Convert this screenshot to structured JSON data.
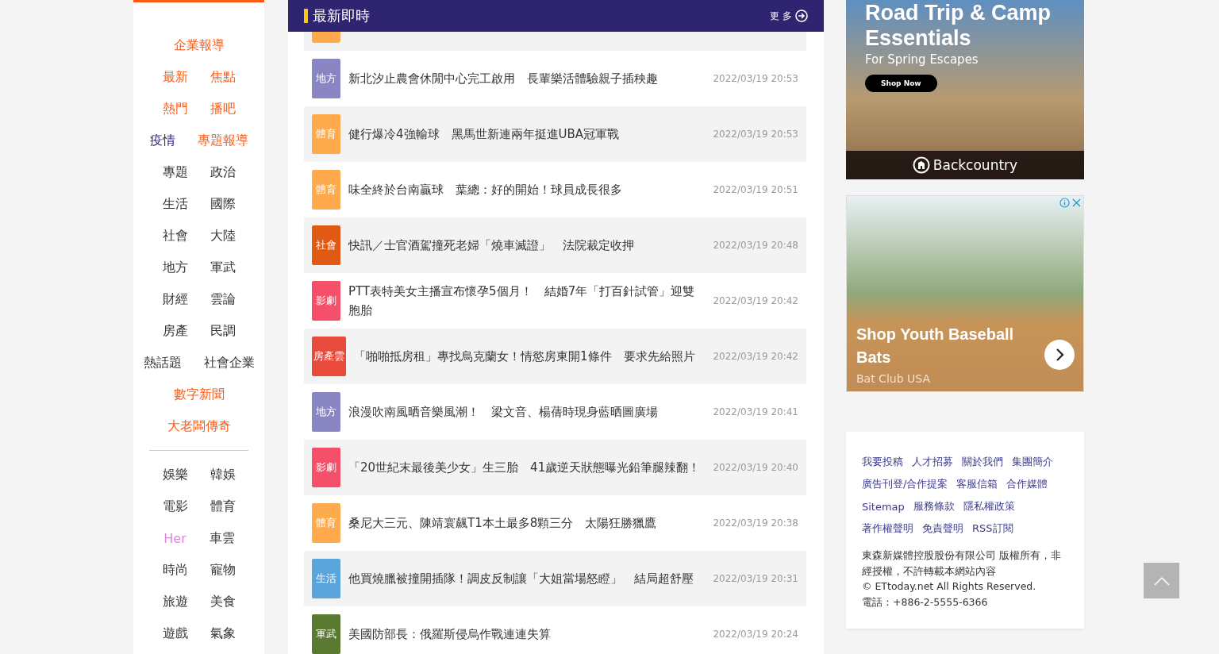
{
  "nav": {
    "sections": [
      [
        [
          {
            "label": "企業報導",
            "color": "#ff5a14"
          }
        ],
        [
          {
            "label": "最新",
            "color": "#ff5a14"
          },
          {
            "label": "焦點",
            "color": "#ff5a14"
          }
        ],
        [
          {
            "label": "熱門",
            "color": "#ff5a14"
          },
          {
            "label": "播吧",
            "color": "#ff5a14"
          }
        ],
        [
          {
            "label": "疫情",
            "color": "#2e2470"
          },
          {
            "label": "專題報導",
            "color": "#ff5a14"
          }
        ],
        [
          {
            "label": "專題",
            "color": "#333333"
          },
          {
            "label": "政治",
            "color": "#333333"
          }
        ],
        [
          {
            "label": "生活",
            "color": "#333333"
          },
          {
            "label": "國際",
            "color": "#333333"
          }
        ],
        [
          {
            "label": "社會",
            "color": "#333333"
          },
          {
            "label": "大陸",
            "color": "#333333"
          }
        ],
        [
          {
            "label": "地方",
            "color": "#333333"
          },
          {
            "label": "軍武",
            "color": "#333333"
          }
        ],
        [
          {
            "label": "財經",
            "color": "#333333"
          },
          {
            "label": "雲論",
            "color": "#333333"
          }
        ],
        [
          {
            "label": "房產",
            "color": "#333333"
          },
          {
            "label": "民調",
            "color": "#333333"
          }
        ],
        [
          {
            "label": "熱話題",
            "color": "#333333"
          },
          {
            "label": "社會企業",
            "color": "#333333"
          }
        ],
        [
          {
            "label": "數字新聞",
            "color": "#ff5a14"
          }
        ],
        [
          {
            "label": "大老闆傳奇",
            "color": "#ff5a14"
          }
        ]
      ],
      [
        [
          {
            "label": "娛樂",
            "color": "#333333"
          },
          {
            "label": "韓娛",
            "color": "#333333"
          }
        ],
        [
          {
            "label": "電影",
            "color": "#333333"
          },
          {
            "label": "體育",
            "color": "#333333"
          }
        ],
        [
          {
            "label": "Her",
            "color": "#e67ee6"
          },
          {
            "label": "車雲",
            "color": "#333333"
          }
        ],
        [
          {
            "label": "時尚",
            "color": "#333333"
          },
          {
            "label": "寵物",
            "color": "#333333"
          }
        ],
        [
          {
            "label": "旅遊",
            "color": "#333333"
          },
          {
            "label": "美食",
            "color": "#333333"
          }
        ],
        [
          {
            "label": "遊戲",
            "color": "#333333"
          },
          {
            "label": "氣象",
            "color": "#333333"
          }
        ]
      ]
    ]
  },
  "news": {
    "title": "最新即時",
    "more": "更 多",
    "cut_row": {
      "color": "#ffaa4d"
    },
    "items": [
      {
        "tag": "地方",
        "color": "#8a86c4",
        "title": "新北汐止農會休閒中心完工啟用　長輩樂活體驗親子插秧趣",
        "time": "2022/03/19 20:53"
      },
      {
        "tag": "體育",
        "color": "#ffaa4d",
        "title": "健行爆冷4強輸球　黑馬世新連兩年挺進UBA冠軍戰",
        "time": "2022/03/19 20:53"
      },
      {
        "tag": "體育",
        "color": "#ffaa4d",
        "title": "味全終於台南贏球　葉總：好的開始！球員成長很多",
        "time": "2022/03/19 20:51"
      },
      {
        "tag": "社會",
        "color": "#e05a14",
        "title": "快訊／士官酒駕撞死老婦「燒車滅證」　法院裁定收押",
        "time": "2022/03/19 20:48"
      },
      {
        "tag": "影劇",
        "color": "#f5506a",
        "title": "PTT表特美女主播宣布懷孕5個月！　結婚7年「打百針試管」迎雙胞胎",
        "time": "2022/03/19 20:42"
      },
      {
        "tag": "房產雲",
        "color": "#e84a3c",
        "title": "「啪啪抵房租」專找烏克蘭女！情慾房東開1條件　要求先給照片",
        "time": "2022/03/19 20:42"
      },
      {
        "tag": "地方",
        "color": "#8a86c4",
        "title": "浪漫吹南風晒音樂風潮！　梁文音、楊蒨時現身藍晒圖廣場",
        "time": "2022/03/19 20:41"
      },
      {
        "tag": "影劇",
        "color": "#f5506a",
        "title": "「20世紀末最後美少女」生三胎　41歲逆天狀態曝光鉛筆腿辣翻！",
        "time": "2022/03/19 20:40"
      },
      {
        "tag": "體育",
        "color": "#ffaa4d",
        "title": "桑尼大三元、陳靖寰飆T1本土最多8顆三分　太陽狂勝獵鷹",
        "time": "2022/03/19 20:38"
      },
      {
        "tag": "生活",
        "color": "#5aa5dc",
        "title": "他買燒臘被撞開插隊！調皮反制讓「大姐當場怒瞪」　結局超舒壓",
        "time": "2022/03/19 20:31"
      },
      {
        "tag": "軍武",
        "color": "#5a7a32",
        "title": "美國防部長：俄羅斯侵烏作戰連連失算",
        "time": "2022/03/19 20:24"
      }
    ]
  },
  "ads": [
    {
      "kind": "banner",
      "headline": "Road Trip & Camp Essentials",
      "subline": "For Spring Escapes",
      "button": "Shop Now",
      "brand": "Backcountry"
    },
    {
      "kind": "card",
      "headline": "Shop Youth Baseball Bats",
      "advertiser": "Bat Club USA"
    }
  ],
  "footer": {
    "link_rows": [
      [
        "我要投稿",
        "人才招募",
        "關於我們",
        "集團簡介"
      ],
      [
        "廣告刊登/合作提案",
        "客服信箱",
        "合作媒體"
      ],
      [
        "Sitemap",
        "服務條款",
        "隱私權政策"
      ],
      [
        "著作權聲明",
        "免責聲明",
        "RSS訂閱"
      ]
    ],
    "copyright": [
      "東森新媒體控股股份有限公司 版權所有，非經授權，不許轉載本網站內容",
      "© ETtoday.net All Rights Reserved.",
      "電話：+886-2-5555-6366"
    ]
  }
}
